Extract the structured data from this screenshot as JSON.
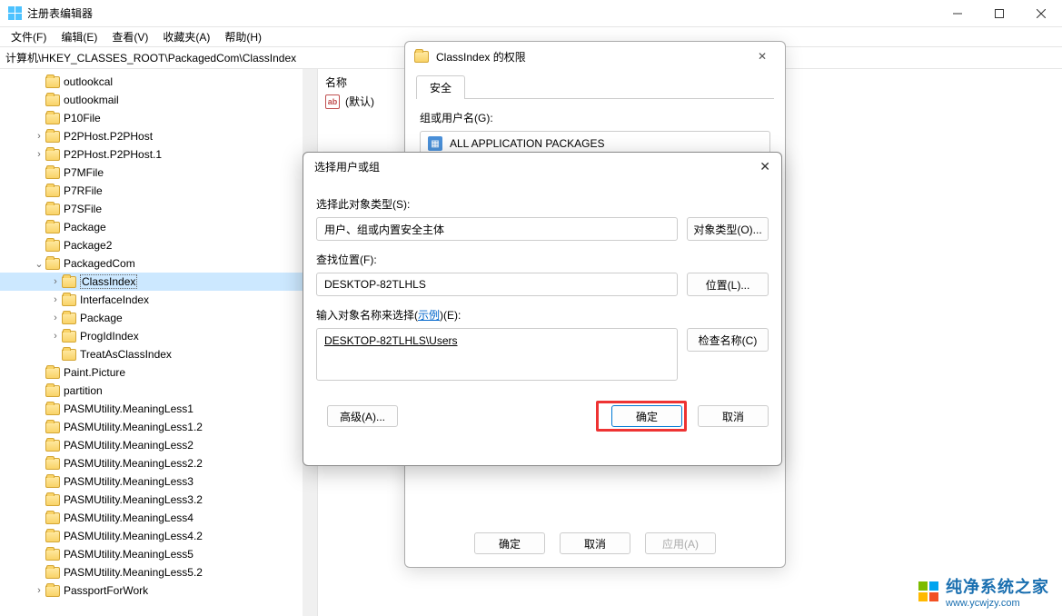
{
  "window": {
    "title": "注册表编辑器"
  },
  "menu": {
    "file": "文件(F)",
    "edit": "编辑(E)",
    "view": "查看(V)",
    "fav": "收藏夹(A)",
    "help": "帮助(H)"
  },
  "address": "计算机\\HKEY_CLASSES_ROOT\\PackagedCom\\ClassIndex",
  "tree": [
    {
      "indent": 2,
      "exp": "",
      "label": "outlookcal"
    },
    {
      "indent": 2,
      "exp": "",
      "label": "outlookmail"
    },
    {
      "indent": 2,
      "exp": "",
      "label": "P10File"
    },
    {
      "indent": 2,
      "exp": ">",
      "label": "P2PHost.P2PHost"
    },
    {
      "indent": 2,
      "exp": ">",
      "label": "P2PHost.P2PHost.1"
    },
    {
      "indent": 2,
      "exp": "",
      "label": "P7MFile"
    },
    {
      "indent": 2,
      "exp": "",
      "label": "P7RFile"
    },
    {
      "indent": 2,
      "exp": "",
      "label": "P7SFile"
    },
    {
      "indent": 2,
      "exp": "",
      "label": "Package"
    },
    {
      "indent": 2,
      "exp": "",
      "label": "Package2"
    },
    {
      "indent": 2,
      "exp": "v",
      "label": "PackagedCom"
    },
    {
      "indent": 3,
      "exp": ">",
      "label": "ClassIndex",
      "sel": true
    },
    {
      "indent": 3,
      "exp": ">",
      "label": "InterfaceIndex"
    },
    {
      "indent": 3,
      "exp": ">",
      "label": "Package"
    },
    {
      "indent": 3,
      "exp": ">",
      "label": "ProgIdIndex"
    },
    {
      "indent": 3,
      "exp": "",
      "label": "TreatAsClassIndex"
    },
    {
      "indent": 2,
      "exp": "",
      "label": "Paint.Picture"
    },
    {
      "indent": 2,
      "exp": "",
      "label": "partition"
    },
    {
      "indent": 2,
      "exp": "",
      "label": "PASMUtility.MeaningLess1"
    },
    {
      "indent": 2,
      "exp": "",
      "label": "PASMUtility.MeaningLess1.2"
    },
    {
      "indent": 2,
      "exp": "",
      "label": "PASMUtility.MeaningLess2"
    },
    {
      "indent": 2,
      "exp": "",
      "label": "PASMUtility.MeaningLess2.2"
    },
    {
      "indent": 2,
      "exp": "",
      "label": "PASMUtility.MeaningLess3"
    },
    {
      "indent": 2,
      "exp": "",
      "label": "PASMUtility.MeaningLess3.2"
    },
    {
      "indent": 2,
      "exp": "",
      "label": "PASMUtility.MeaningLess4"
    },
    {
      "indent": 2,
      "exp": "",
      "label": "PASMUtility.MeaningLess4.2"
    },
    {
      "indent": 2,
      "exp": "",
      "label": "PASMUtility.MeaningLess5"
    },
    {
      "indent": 2,
      "exp": "",
      "label": "PASMUtility.MeaningLess5.2"
    },
    {
      "indent": 2,
      "exp": ">",
      "label": "PassportForWork"
    }
  ],
  "values": {
    "header_name": "名称",
    "default_name": "(默认)",
    "ab": "ab"
  },
  "perm": {
    "title": "ClassIndex 的权限",
    "tab": "安全",
    "group_label": "组或用户名(G):",
    "group_item": "ALL APPLICATION PACKAGES",
    "ok": "确定",
    "cancel": "取消",
    "apply": "应用(A)"
  },
  "sel": {
    "title": "选择用户或组",
    "obj_type_lbl": "选择此对象类型(S):",
    "obj_type_val": "用户、组或内置安全主体",
    "obj_type_btn": "对象类型(O)...",
    "loc_lbl": "查找位置(F):",
    "loc_val": "DESKTOP-82TLHLS",
    "loc_btn": "位置(L)...",
    "name_lbl_pre": "输入对象名称来选择(",
    "name_lbl_link": "示例",
    "name_lbl_post": ")(E):",
    "name_val": "DESKTOP-82TLHLS\\Users",
    "check_btn": "检查名称(C)",
    "adv_btn": "高级(A)...",
    "ok": "确定",
    "cancel": "取消"
  },
  "watermark": {
    "text": "纯净系统之家",
    "url": "www.ycwjzy.com"
  }
}
